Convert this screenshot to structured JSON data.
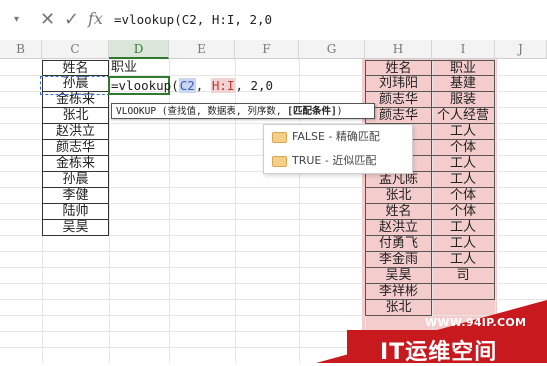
{
  "formula_bar": {
    "dropdown": "▾",
    "cancel": "✕",
    "confirm": "✓",
    "fx": "fx",
    "formula": "=vlookup(C2, H:I, 2,0"
  },
  "columns": [
    "B",
    "C",
    "D",
    "E",
    "F",
    "G",
    "H",
    "I",
    "J"
  ],
  "col_c": [
    "姓名",
    "孙晨",
    "金栋来",
    "张北",
    "赵洪立",
    "颜志华",
    "金栋来",
    "孙晨",
    "李健",
    "陆帅",
    "吴昊"
  ],
  "col_d_header": "职业",
  "inline_formula": {
    "prefix": "=vlookup(",
    "ref1": "C2",
    "sep": ", ",
    "ref2": "H:I",
    "suffix": ", 2,0"
  },
  "tooltip": {
    "prefix": "VLOOKUP (查找值, 数据表, 列序数, ",
    "bold": "[匹配条件]",
    "suffix": ")"
  },
  "menu": {
    "items": [
      {
        "label": "FALSE - 精确匹配"
      },
      {
        "label": "TRUE - 近似匹配"
      }
    ]
  },
  "col_h": [
    "姓名",
    "刘玮阳",
    "颜志华",
    "颜志华",
    "",
    "",
    "陆帅",
    "孟凡陈",
    "张北",
    "姓名",
    "赵洪立",
    "付勇飞",
    "李金雨",
    "吴昊",
    "李祥彬",
    "张北"
  ],
  "col_i": [
    "职业",
    "基建",
    "服装",
    "个人经营",
    "工人",
    "个体",
    "工人",
    "工人",
    "个体",
    "个体",
    "工人",
    "工人",
    "工人",
    "司",
    ""
  ],
  "watermark": {
    "url": "WWW.94IP.COM",
    "brand": "IT运维空间"
  }
}
